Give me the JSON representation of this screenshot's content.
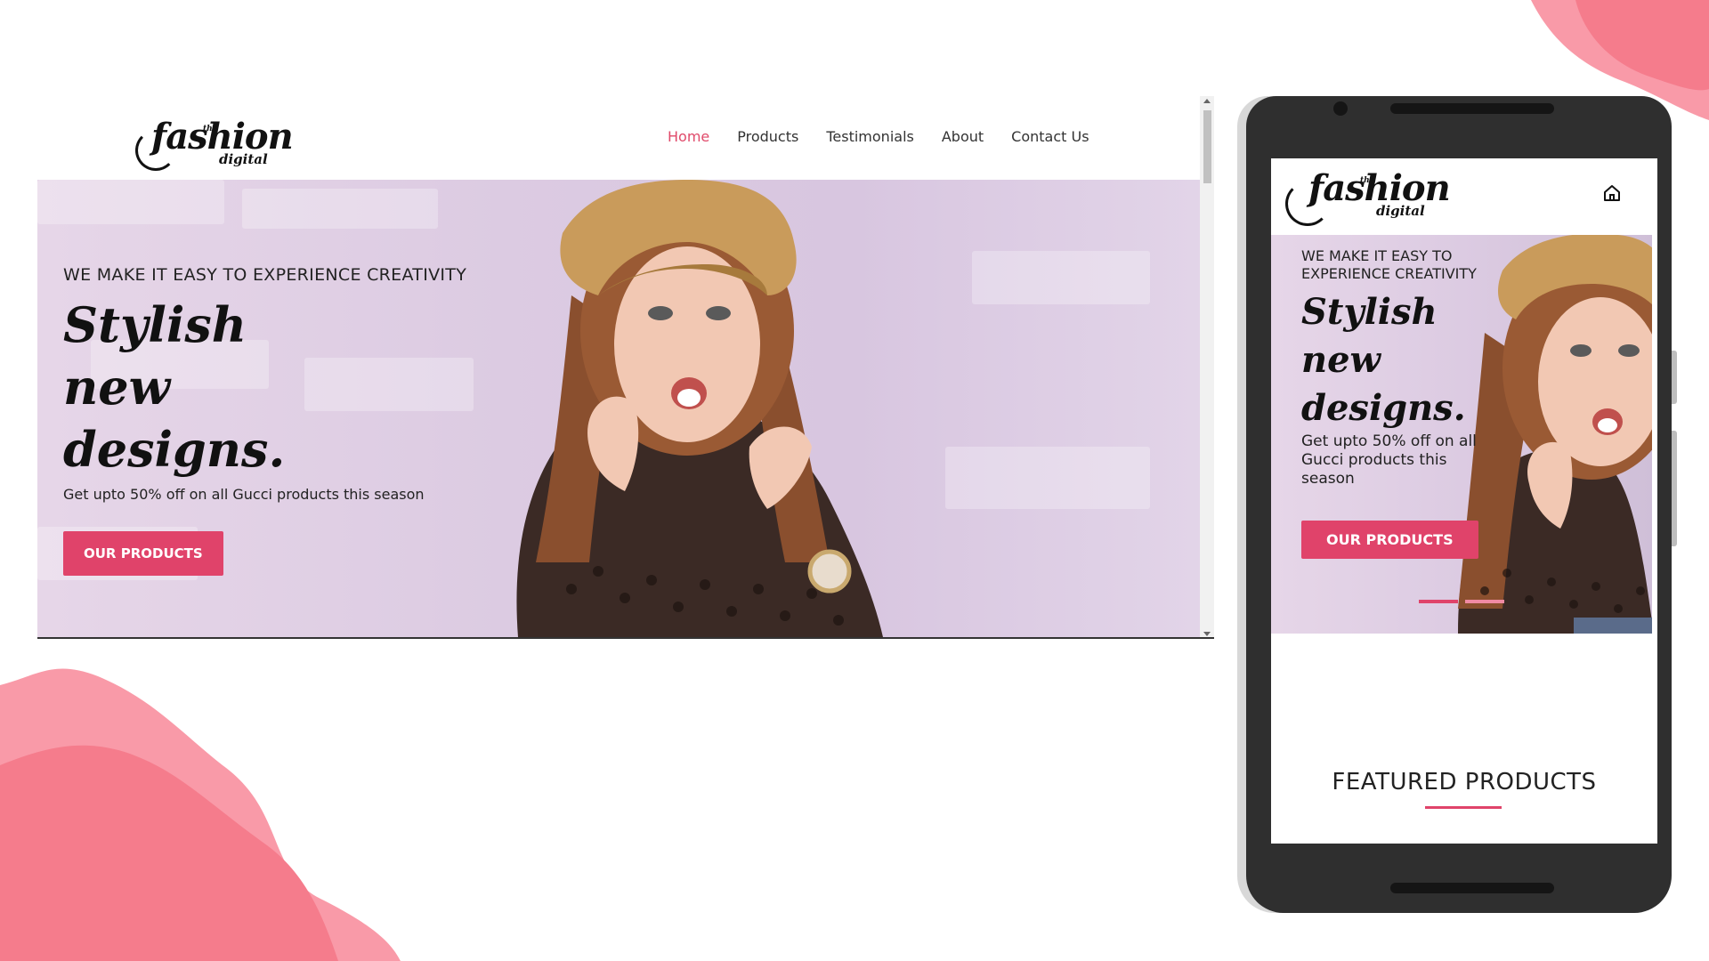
{
  "brand": {
    "logo_script": "fashion",
    "logo_sub": "digital",
    "logo_the": "the",
    "accent_color": "#e0436a"
  },
  "desktop": {
    "nav": {
      "items": [
        {
          "label": "Home",
          "active": true
        },
        {
          "label": "Products",
          "active": false
        },
        {
          "label": "Testimonials",
          "active": false
        },
        {
          "label": "About",
          "active": false
        },
        {
          "label": "Contact Us",
          "active": false
        }
      ]
    },
    "hero": {
      "eyebrow": "WE MAKE IT EASY TO EXPERIENCE CREATIVITY",
      "headline_line1": "Stylish",
      "headline_line2": "new",
      "headline_line3": "designs.",
      "offer": "Get upto 50% off on all Gucci products this season",
      "cta_label": "OUR PRODUCTS"
    }
  },
  "mobile": {
    "home_icon": "home-icon",
    "hero": {
      "eyebrow_line1": "WE MAKE IT EASY TO",
      "eyebrow_line2": "EXPERIENCE CREATIVITY",
      "headline_line1": "Stylish",
      "headline_line2": "new",
      "headline_line3": "designs.",
      "offer_line1": "Get upto 50% off on all",
      "offer_line2": "Gucci products this",
      "offer_line3": "season",
      "cta_label": "OUR PRODUCTS"
    },
    "featured_title": "FEATURED PRODUCTS"
  }
}
